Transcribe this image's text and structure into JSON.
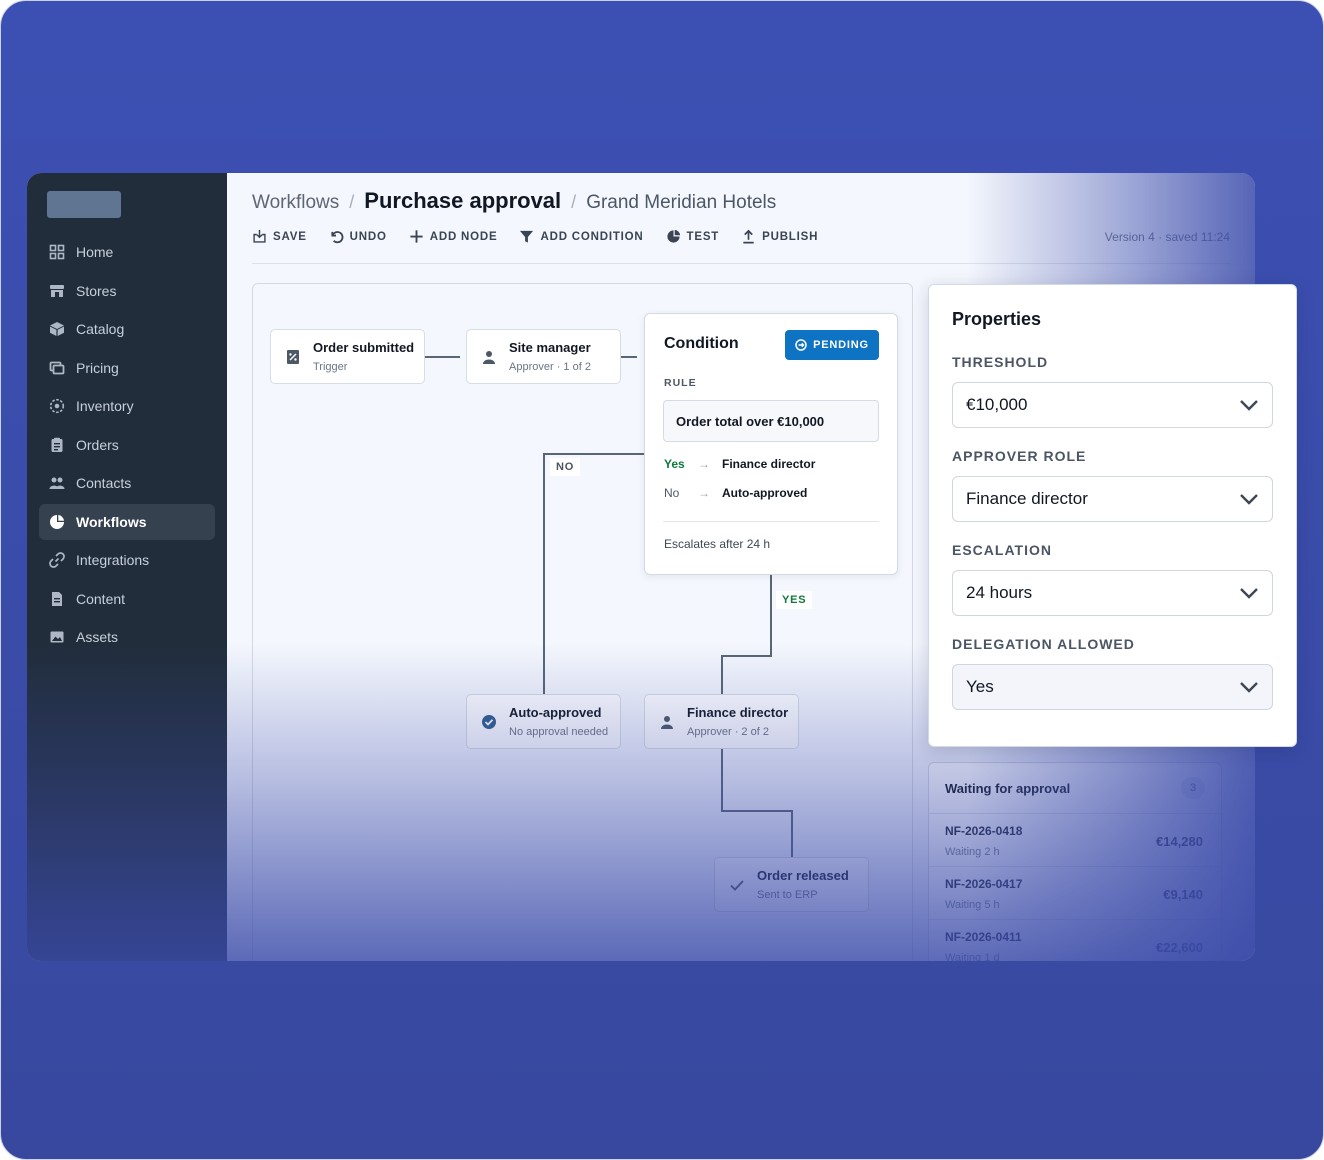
{
  "sidebar": {
    "items": [
      {
        "label": "Home",
        "icon": "grid-icon"
      },
      {
        "label": "Stores",
        "icon": "store-icon"
      },
      {
        "label": "Catalog",
        "icon": "box-icon"
      },
      {
        "label": "Pricing",
        "icon": "tag-icon"
      },
      {
        "label": "Inventory",
        "icon": "inventory-icon"
      },
      {
        "label": "Orders",
        "icon": "clipboard-icon"
      },
      {
        "label": "Contacts",
        "icon": "users-icon"
      },
      {
        "label": "Workflows",
        "icon": "workflow-icon",
        "active": true
      },
      {
        "label": "Integrations",
        "icon": "link-icon"
      },
      {
        "label": "Content",
        "icon": "document-icon"
      },
      {
        "label": "Assets",
        "icon": "image-icon"
      }
    ]
  },
  "breadcrumb": {
    "parent": "Workflows",
    "sep1": "/",
    "current": "Purchase approval",
    "sep2": "/",
    "org": "Grand Meridian Hotels"
  },
  "toolbar": {
    "save": "SAVE",
    "undo": "UNDO",
    "add_node": "ADD NODE",
    "add_condition": "ADD CONDITION",
    "test": "TEST",
    "publish": "PUBLISH",
    "version": "Version 4 · saved 11:24"
  },
  "flow": {
    "order_submitted": {
      "title": "Order submitted",
      "sub": "Trigger"
    },
    "site_manager": {
      "title": "Site manager",
      "sub": "Approver · 1 of 2"
    },
    "auto_approved": {
      "title": "Auto-approved",
      "sub": "No approval needed"
    },
    "finance_director": {
      "title": "Finance director",
      "sub": "Approver · 2 of 2"
    },
    "order_released": {
      "title": "Order released",
      "sub": "Sent to ERP"
    },
    "no_tag": "NO",
    "yes_tag": "YES"
  },
  "condition": {
    "title": "Condition",
    "status": "PENDING",
    "rule_label": "RULE",
    "rule": "Order total over €10,000",
    "yes_key": "Yes",
    "yes_val": "Finance director",
    "no_key": "No",
    "no_val": "Auto-approved",
    "arrow": "→",
    "escalates": "Escalates after 24 h"
  },
  "properties": {
    "title": "Properties",
    "threshold_label": "THRESHOLD",
    "threshold": "€10,000",
    "approver_label": "APPROVER ROLE",
    "approver": "Finance director",
    "escalation_label": "ESCALATION",
    "escalation": "24 hours",
    "delegation_label": "DELEGATION ALLOWED",
    "delegation": "Yes"
  },
  "waiting": {
    "title": "Waiting for approval",
    "count": "3",
    "rows": [
      {
        "id": "NF-2026-0418",
        "time": "Waiting 2 h",
        "amount": "€14,280"
      },
      {
        "id": "NF-2026-0417",
        "time": "Waiting 5 h",
        "amount": "€9,140"
      },
      {
        "id": "NF-2026-0411",
        "time": "Waiting 1 d",
        "amount": "€22,600"
      }
    ]
  },
  "colors": {
    "backdrop": "#3c50b4",
    "sidebar": "#212d3b",
    "accent": "#0e73c2",
    "yes": "#0f7a3d"
  }
}
